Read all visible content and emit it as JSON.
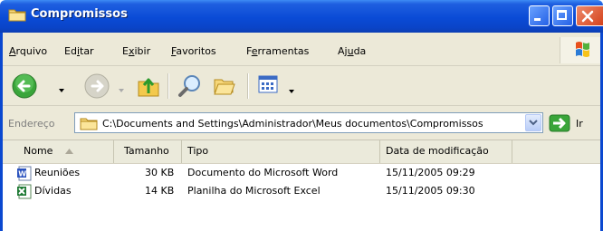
{
  "window": {
    "title": "Compromissos"
  },
  "menu": [
    {
      "pre": "",
      "u": "A",
      "post": "rquivo"
    },
    {
      "pre": "Ed",
      "u": "i",
      "post": "tar"
    },
    {
      "pre": "E",
      "u": "x",
      "post": "ibir"
    },
    {
      "pre": "",
      "u": "F",
      "post": "avoritos"
    },
    {
      "pre": "F",
      "u": "e",
      "post": "rramentas"
    },
    {
      "pre": "Aj",
      "u": "u",
      "post": "da"
    }
  ],
  "toolbar": {
    "icons": [
      "back-icon",
      "forward-icon",
      "up-folder-icon",
      "search-icon",
      "folders-icon",
      "views-icon"
    ]
  },
  "address": {
    "label": "Endereço",
    "path": "C:\\Documents and Settings\\Administrador\\Meus documentos\\Compromissos",
    "go_label": "Ir"
  },
  "columns": {
    "name": "Nome",
    "size": "Tamanho",
    "type": "Tipo",
    "modified": "Data de modificação"
  },
  "files": [
    {
      "name": "Reuniões",
      "size": "30 KB",
      "type": "Documento do Microsoft Word",
      "modified": "15/11/2005 09:29",
      "icon": "word-document-icon"
    },
    {
      "name": "Dívidas",
      "size": "14 KB",
      "type": "Planilha do Microsoft Excel",
      "modified": "15/11/2005 09:30",
      "icon": "excel-spreadsheet-icon"
    }
  ],
  "colors": {
    "titlebar": "#0a4bd6",
    "chrome": "#ece9d8",
    "close_button": "#d4421c"
  }
}
